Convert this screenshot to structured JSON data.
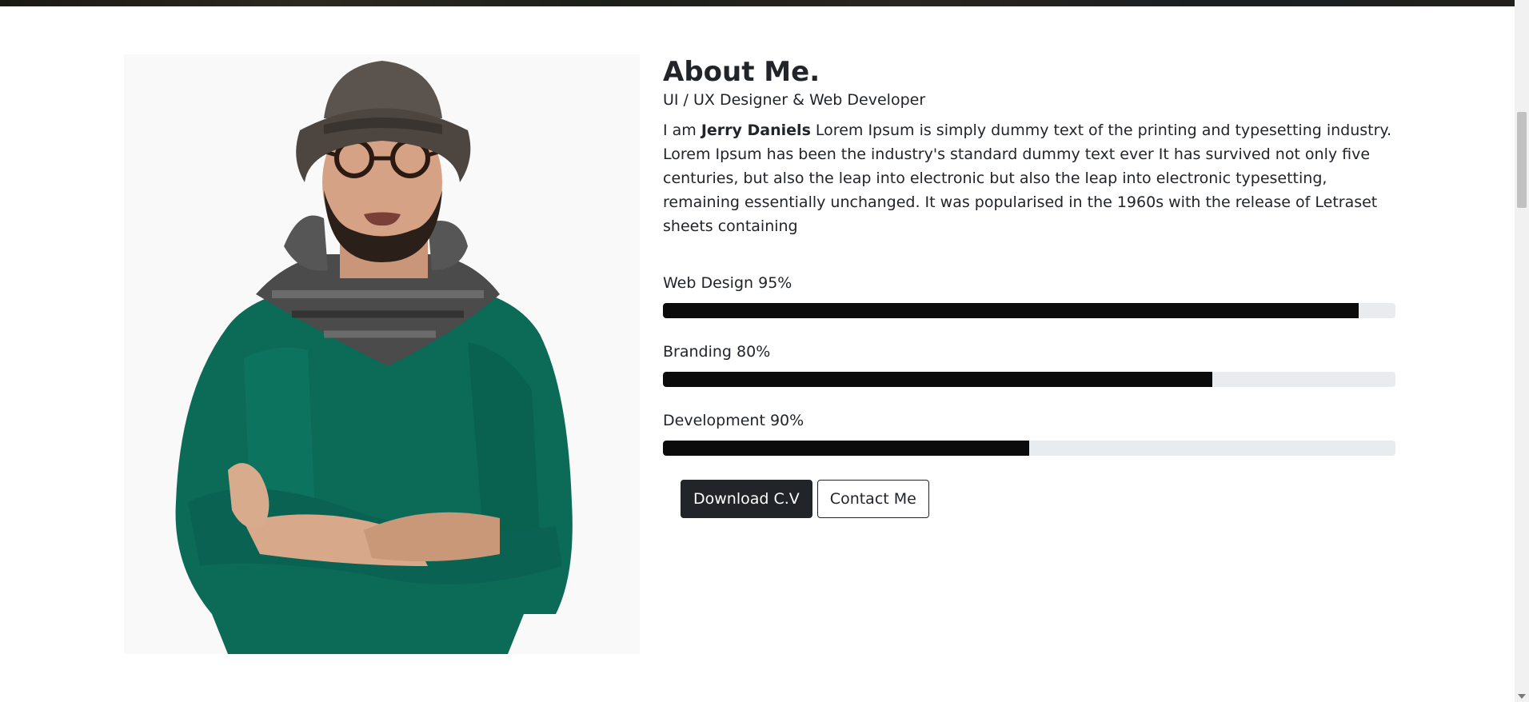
{
  "about": {
    "title": "About Me.",
    "subtitle": "UI / UX Designer & Web Developer",
    "bio_intro": "I am ",
    "bio_name": "Jerry Daniels",
    "bio_text": " Lorem Ipsum is simply dummy text of the printing and typesetting industry. Lorem Ipsum has been the industry's standard dummy text ever It has survived not only five centuries, but also the leap into electronic but also the leap into electronic typesetting, remaining essentially unchanged. It was popularised in the 1960s with the release of Letraset sheets containing"
  },
  "skills": [
    {
      "label": "Web Design 95%",
      "fill": 0.95
    },
    {
      "label": "Branding 80%",
      "fill": 0.75
    },
    {
      "label": "Development 90%",
      "fill": 0.5
    }
  ],
  "buttons": {
    "download_label": "Download C.V",
    "contact_label": "Contact Me"
  },
  "colors": {
    "progress_fill": "#0b0b0b",
    "progress_track": "#e9ecef",
    "button_dark": "#212529",
    "sweater": "#0b6b57"
  },
  "icons": {
    "scroll_down": "chevron-down-icon"
  }
}
